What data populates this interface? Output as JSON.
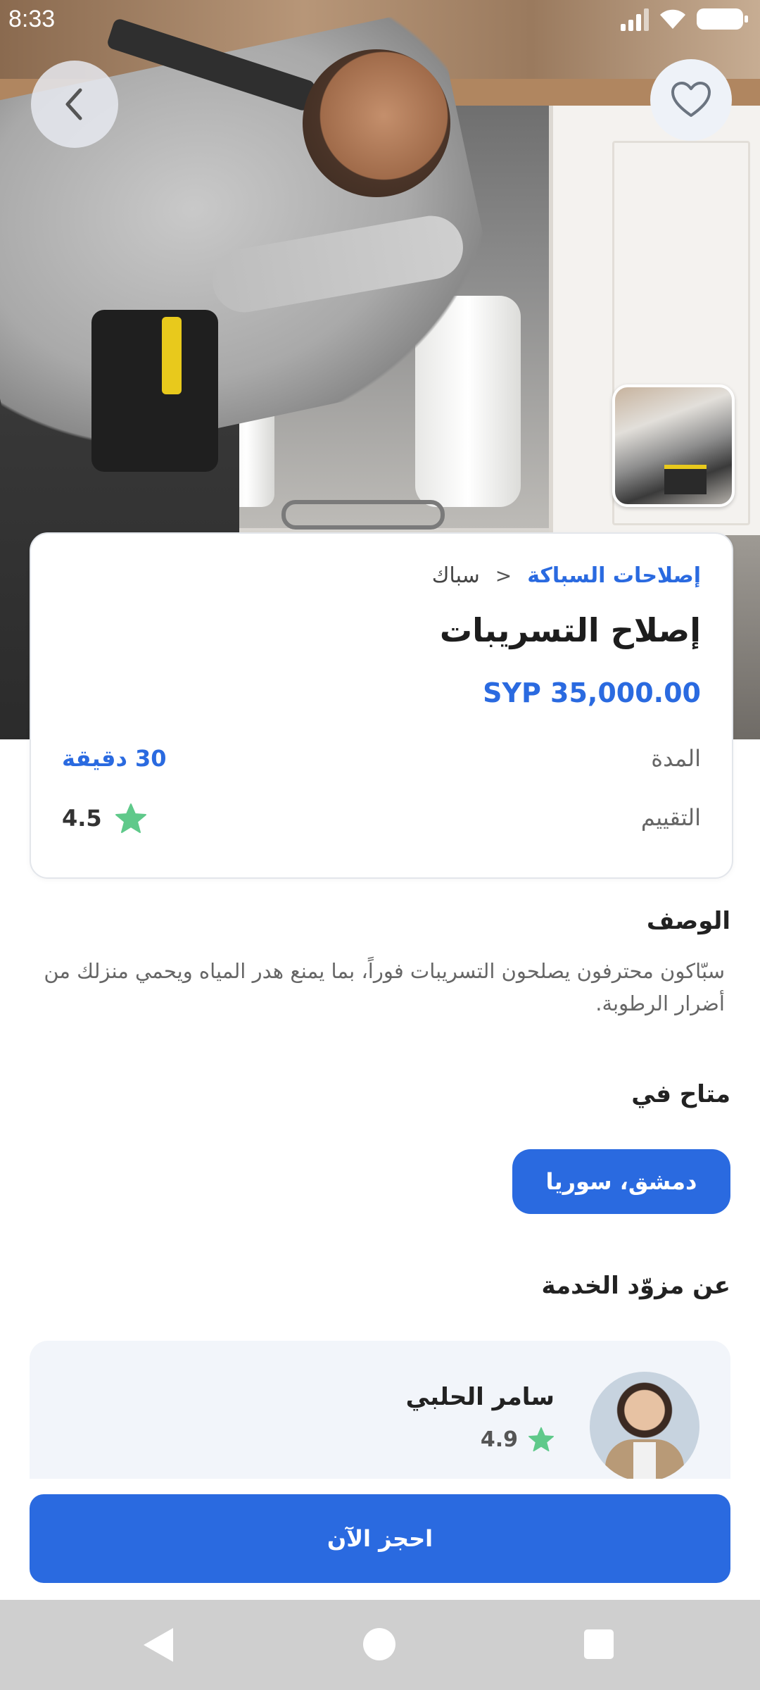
{
  "status_bar": {
    "time": "8:33"
  },
  "breadcrumb": {
    "category": "إصلاحات السباكة",
    "separator": ">",
    "subcategory": "سباك"
  },
  "service": {
    "title": "إصلاح التسريبات",
    "price": "SYP 35,000.00",
    "duration_label": "المدة",
    "duration_value": "30 دقيقة",
    "rating_label": "التقييم",
    "rating_value": "4.5"
  },
  "description": {
    "title": "الوصف",
    "text": "سبّاكون محترفون يصلحون التسريبات فوراً، بما يمنع هدر المياه ويحمي منزلك من أضرار الرطوبة."
  },
  "availability": {
    "title": "متاح في",
    "location": "دمشق، سوريا"
  },
  "provider": {
    "section_title": "عن مزوّد الخدمة",
    "name": "سامر الحلبي",
    "rating": "4.9"
  },
  "actions": {
    "book_label": "احجز الآن"
  },
  "colors": {
    "accent": "#2a6ae0",
    "star": "#5fc98a",
    "card_bg": "#f2f5fa"
  },
  "icons": [
    "back-icon",
    "heart-icon",
    "star-icon",
    "nav-back-icon",
    "nav-home-icon",
    "nav-recents-icon"
  ]
}
